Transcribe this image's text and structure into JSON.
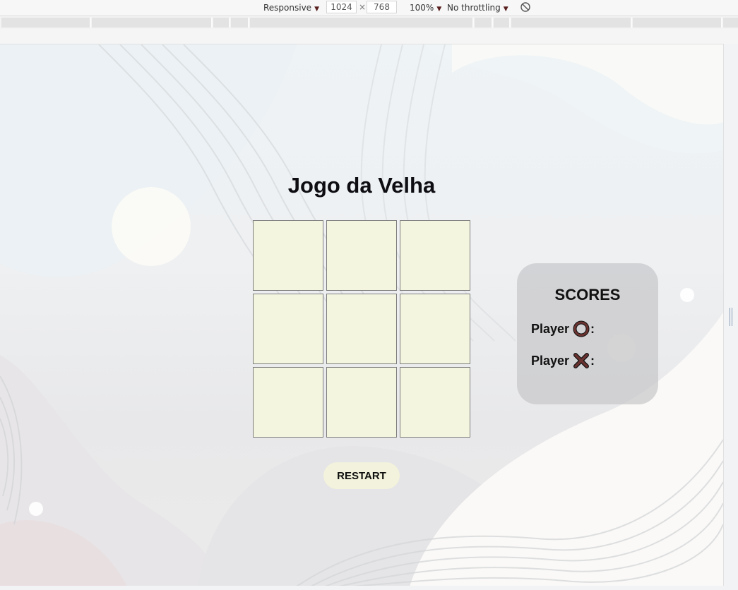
{
  "devtools": {
    "device": "Responsive",
    "width": "1024",
    "height": "768",
    "times": "×",
    "zoom": "100%",
    "throttling": "No throttling"
  },
  "game": {
    "title": "Jogo da Velha",
    "cells": [
      "",
      "",
      "",
      "",
      "",
      "",
      "",
      "",
      ""
    ],
    "restart_label": "RESTART"
  },
  "scores": {
    "title": "SCORES",
    "player_label": "Player",
    "colon": ":",
    "o_score": "",
    "x_score": ""
  },
  "colors": {
    "cell_bg": "#f4f5df",
    "o_mark": "#6b3330",
    "x_mark": "#6b3330"
  }
}
